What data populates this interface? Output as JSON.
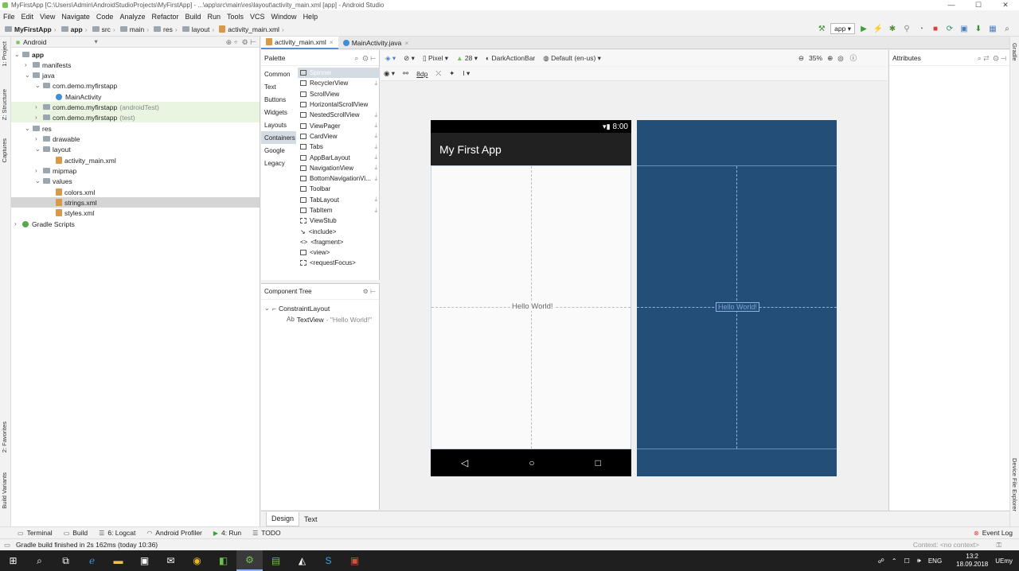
{
  "window": {
    "title": "MyFirstApp [C:\\Users\\Admin\\AndroidStudioProjects\\MyFirstApp] - ...\\app\\src\\main\\res\\layout\\activity_main.xml [app] - Android Studio"
  },
  "menu": [
    "File",
    "Edit",
    "View",
    "Navigate",
    "Code",
    "Analyze",
    "Refactor",
    "Build",
    "Run",
    "Tools",
    "VCS",
    "Window",
    "Help"
  ],
  "breadcrumb": [
    "MyFirstApp",
    "app",
    "src",
    "main",
    "res",
    "layout",
    "activity_main.xml"
  ],
  "run_config": "app",
  "project_panel": {
    "view": "Android",
    "tree": [
      {
        "label": "app",
        "note": ""
      },
      {
        "label": "manifests",
        "note": ""
      },
      {
        "label": "java",
        "note": ""
      },
      {
        "label": "com.demo.myfirstapp",
        "note": ""
      },
      {
        "label": "MainActivity",
        "note": ""
      },
      {
        "label": "com.demo.myfirstapp",
        "note": "(androidTest)"
      },
      {
        "label": "com.demo.myfirstapp",
        "note": "(test)"
      },
      {
        "label": "res",
        "note": ""
      },
      {
        "label": "drawable",
        "note": ""
      },
      {
        "label": "layout",
        "note": ""
      },
      {
        "label": "activity_main.xml",
        "note": ""
      },
      {
        "label": "mipmap",
        "note": ""
      },
      {
        "label": "values",
        "note": ""
      },
      {
        "label": "colors.xml",
        "note": ""
      },
      {
        "label": "strings.xml",
        "note": ""
      },
      {
        "label": "styles.xml",
        "note": ""
      },
      {
        "label": "Gradle Scripts",
        "note": ""
      }
    ]
  },
  "side_tabs_left": [
    "1: Project",
    "Z: Structure",
    "Captures",
    "2: Favorites",
    "Build Variants"
  ],
  "side_tabs_right": [
    "Gradle",
    "Device File Explorer"
  ],
  "editor_tabs": [
    "activity_main.xml",
    "MainActivity.java"
  ],
  "palette": {
    "title": "Palette",
    "categories": [
      "Common",
      "Text",
      "Buttons",
      "Widgets",
      "Layouts",
      "Containers",
      "Google",
      "Legacy"
    ],
    "selected_category": "Containers",
    "items": [
      "Spinner",
      "RecyclerView",
      "ScrollView",
      "HorizontalScrollView",
      "NestedScrollView",
      "ViewPager",
      "CardView",
      "Tabs",
      "AppBarLayout",
      "NavigationView",
      "BottomNavigationVi...",
      "Toolbar",
      "TabLayout",
      "TabItem",
      "ViewStub",
      "<include>",
      "<fragment>",
      "<view>",
      "<requestFocus>"
    ]
  },
  "component_tree": {
    "title": "Component Tree",
    "root": "ConstraintLayout",
    "child_prefix": "Ab",
    "child": "TextView",
    "child_value": "- \"Hello World!\""
  },
  "design_toolbar": {
    "device": "Pixel",
    "api": "28",
    "theme": "DarkActionBar",
    "locale": "Default (en-us)",
    "zoom": "35%",
    "margin": "8dp"
  },
  "phone": {
    "time": "8:00",
    "app_title": "My First App",
    "text": "Hello World!"
  },
  "blueprint_text": "Hello World!",
  "attributes": {
    "title": "Attributes"
  },
  "design_tabs": [
    "Design",
    "Text"
  ],
  "bottom_tools": [
    "Terminal",
    "Build",
    "6: Logcat",
    "Android Profiler",
    "4: Run",
    "TODO"
  ],
  "event_log": "Event Log",
  "status": {
    "message": "Gradle build finished in 2s 162ms (today 10:36)",
    "context": "Context: <no context>"
  },
  "tray": {
    "lang": "ENG",
    "time": "13:2",
    "date": "18.09.2018",
    "user": "UEmy"
  }
}
